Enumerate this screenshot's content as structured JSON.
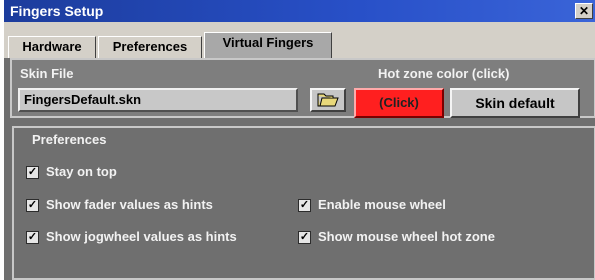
{
  "window": {
    "title": "Fingers Setup",
    "close_glyph": "✕"
  },
  "tabs": [
    {
      "label": "Hardware",
      "active": false
    },
    {
      "label": "Preferences",
      "active": false
    },
    {
      "label": "Virtual Fingers",
      "active": true
    }
  ],
  "skin": {
    "label": "Skin File",
    "file_value": "FingersDefault.skn",
    "browse_icon": "folder-icon",
    "hotzone_label": "Hot zone color (click)",
    "hotzone_button": "(Click)",
    "hotzone_color": "#ff1f1f",
    "default_button": "Skin default"
  },
  "preferences": {
    "title": "Preferences",
    "items": [
      {
        "label": "Stay on top",
        "checked": true
      },
      {
        "label": "Show fader values as hints",
        "checked": true
      },
      {
        "label": "Enable mouse wheel",
        "checked": true
      },
      {
        "label": "Show jogwheel values as hints",
        "checked": true
      },
      {
        "label": "Show mouse wheel hot zone",
        "checked": true
      }
    ]
  }
}
